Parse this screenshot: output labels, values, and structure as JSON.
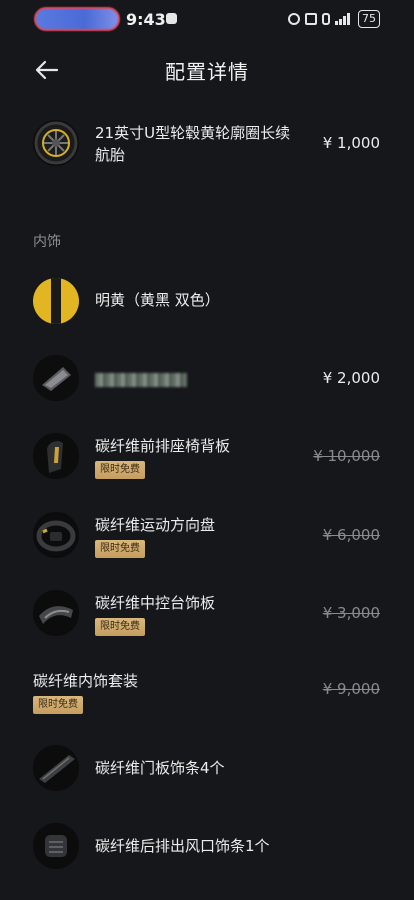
{
  "status": {
    "time": "9:43",
    "battery": "75"
  },
  "header": {
    "title": "配置详情"
  },
  "wheel": {
    "name": "21英寸U型轮毂黄轮廓圈长续航胎",
    "price": "¥ 1,000"
  },
  "interior": {
    "section_label": "内饰",
    "color_option": {
      "name": "明黄（黄黑 双色）"
    },
    "blurred_item": {
      "price": "¥ 2,000"
    },
    "items": [
      {
        "name": "碳纤维前排座椅背板",
        "badge": "限时免费",
        "price": "¥ 10,000"
      },
      {
        "name": "碳纤维运动方向盘",
        "badge": "限时免费",
        "price": "¥ 6,000"
      },
      {
        "name": "碳纤维中控台饰板",
        "badge": "限时免费",
        "price": "¥ 3,000"
      }
    ],
    "package": {
      "name": "碳纤维内饰套装",
      "badge": "限时免费",
      "price": "¥ 9,000"
    },
    "package_items": [
      {
        "name": "碳纤维门板饰条4个"
      },
      {
        "name": "碳纤维后排出风口饰条1个"
      }
    ]
  }
}
